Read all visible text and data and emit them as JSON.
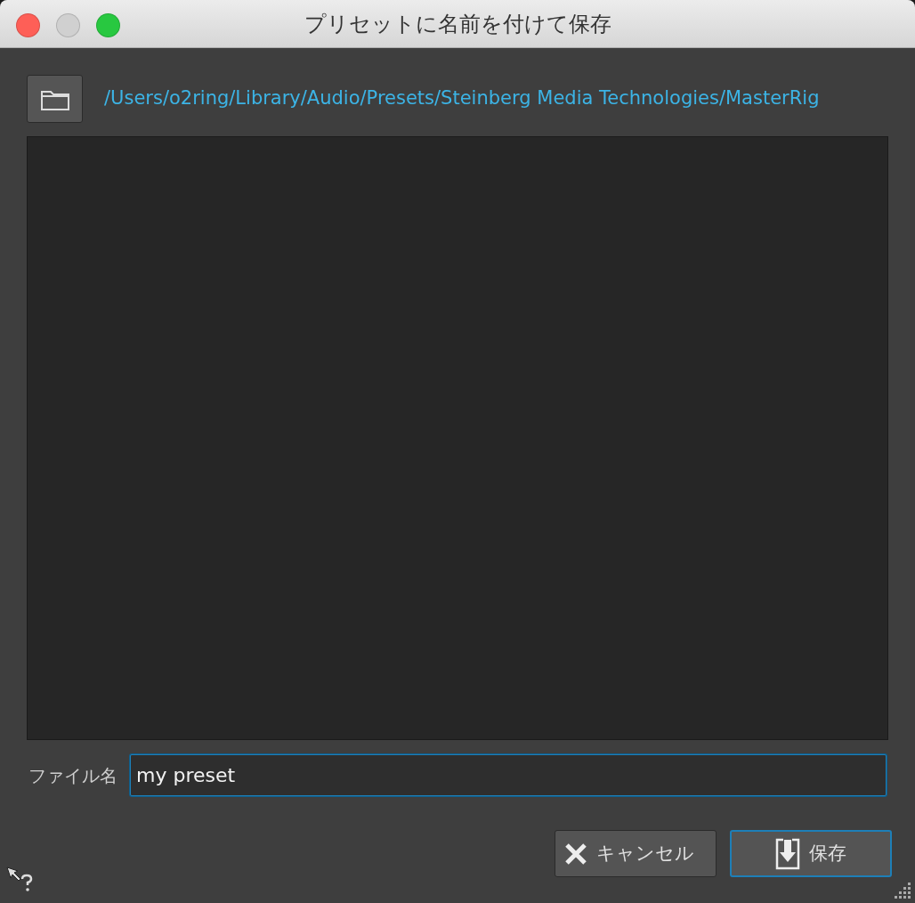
{
  "window": {
    "title": "プリセットに名前を付けて保存"
  },
  "path": "/Users/o2ring/Library/Audio/Presets/Steinberg Media Technologies/MasterRig",
  "file_name": {
    "label": "ファイル名",
    "value": "my preset",
    "focused": true
  },
  "buttons": [
    {
      "kind": "cancel",
      "label": "キャンセル",
      "default": false
    },
    {
      "kind": "save",
      "label": "保存",
      "default": true
    }
  ]
}
